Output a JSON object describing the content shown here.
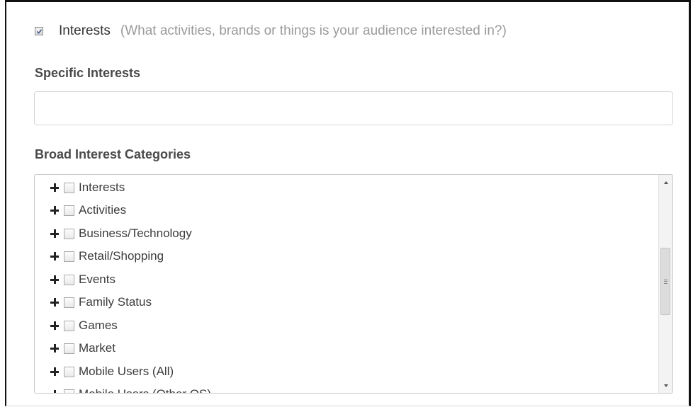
{
  "interests_section": {
    "checked": true,
    "title": "Interests",
    "hint": "(What activities, brands or things is your audience interested in?)"
  },
  "specific_interests": {
    "label": "Specific Interests",
    "value": "",
    "placeholder": ""
  },
  "broad_categories": {
    "label": "Broad Interest Categories",
    "items": [
      {
        "label": "Interests",
        "checked": false
      },
      {
        "label": "Activities",
        "checked": false
      },
      {
        "label": "Business/Technology",
        "checked": false
      },
      {
        "label": "Retail/Shopping",
        "checked": false
      },
      {
        "label": "Events",
        "checked": false
      },
      {
        "label": "Family Status",
        "checked": false
      },
      {
        "label": "Games",
        "checked": false
      },
      {
        "label": "Market",
        "checked": false
      },
      {
        "label": "Mobile Users (All)",
        "checked": false
      },
      {
        "label": "Mobile Users (Other OS)",
        "checked": false
      }
    ]
  },
  "icons": {
    "expand": "plus-icon",
    "scroll_up": "chevron-up-icon",
    "scroll_down": "chevron-down-icon"
  },
  "colors": {
    "checkmark": "#4a5f8a",
    "label_text": "#4a4a4a",
    "hint_text": "#9a9a9a"
  }
}
